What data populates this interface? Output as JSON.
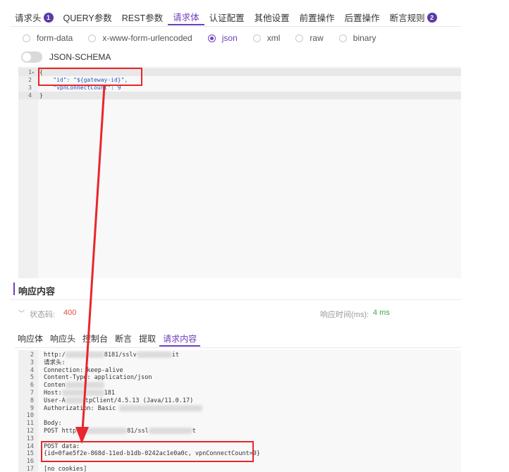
{
  "request_tabs": [
    {
      "label": "请求头",
      "badge": "1"
    },
    {
      "label": "QUERY参数",
      "badge": ""
    },
    {
      "label": "REST参数",
      "badge": ""
    },
    {
      "label": "请求体",
      "badge": "",
      "active": true
    },
    {
      "label": "认证配置",
      "badge": ""
    },
    {
      "label": "其他设置",
      "badge": ""
    },
    {
      "label": "前置操作",
      "badge": ""
    },
    {
      "label": "后置操作",
      "badge": ""
    },
    {
      "label": "断言规则",
      "badge": "2"
    }
  ],
  "body_types": [
    {
      "label": "form-data",
      "checked": false
    },
    {
      "label": "x-www-form-urlencoded",
      "checked": false
    },
    {
      "label": "json",
      "checked": true
    },
    {
      "label": "xml",
      "checked": false
    },
    {
      "label": "raw",
      "checked": false
    },
    {
      "label": "binary",
      "checked": false
    }
  ],
  "json_schema_label": "JSON-SCHEMA",
  "request_body_lines": [
    {
      "n": "1",
      "fold": "▾",
      "text": "{"
    },
    {
      "n": "2",
      "fold": "",
      "text": "    \"id\": \"${gateway-id}\","
    },
    {
      "n": "3",
      "fold": "",
      "text": "    \"vpnConnectCount\": 9"
    },
    {
      "n": "4",
      "fold": "",
      "text": "}"
    }
  ],
  "response": {
    "title": "响应内容",
    "status_label": "状态码:",
    "status_code": "400",
    "time_label": "响应时间(ms):",
    "time_value": "4 ms",
    "tabs": [
      "响应体",
      "响应头",
      "控制台",
      "断言",
      "提取",
      "请求内容"
    ],
    "active_tab": "请求内容",
    "lines": [
      {
        "n": "2",
        "text": "http:/",
        "redacted_a": "8181/sslv",
        "redacted_b": "it"
      },
      {
        "n": "3",
        "text": "请求头:"
      },
      {
        "n": "4",
        "text": "Connection: keep-alive"
      },
      {
        "n": "5",
        "text": "Content-Type: application/json"
      },
      {
        "n": "6",
        "text": "Conten"
      },
      {
        "n": "7",
        "text": "Host:",
        "tail": "181"
      },
      {
        "n": "8",
        "text": "User-A",
        "tail": "tpClient/4.5.13 (Java/11.0.17)"
      },
      {
        "n": "9",
        "text": "Authorization: Basic"
      },
      {
        "n": "10",
        "text": ""
      },
      {
        "n": "11",
        "text": "Body:"
      },
      {
        "n": "12",
        "text": "POST http",
        "tail": "81/ssl",
        "tail2": "t"
      },
      {
        "n": "13",
        "text": ""
      },
      {
        "n": "14",
        "text": "POST data:"
      },
      {
        "n": "15",
        "text": "{id=0fae5f2e-868d-11ed-b1db-0242ac1e0a0c, vpnConnectCount=9}"
      },
      {
        "n": "16",
        "text": ""
      },
      {
        "n": "17",
        "text": "[no cookies]"
      }
    ]
  },
  "colors": {
    "accent": "#6e3fbd",
    "badge": "#5b3aa8",
    "status_error": "#e64c3c",
    "time_ok": "#3daa4b",
    "annotation": "#e8262b"
  }
}
